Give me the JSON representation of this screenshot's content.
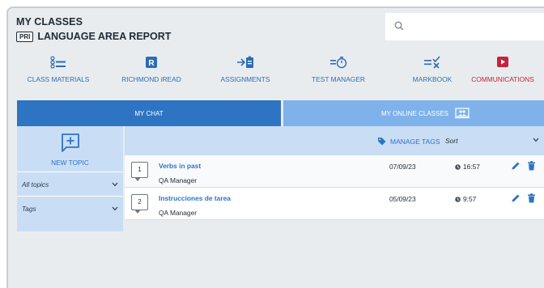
{
  "header": {
    "title": "MY CLASSES",
    "badge": "PRI",
    "subtitle": "LANGUAGE AREA REPORT"
  },
  "search": {
    "placeholder": ""
  },
  "nav": [
    {
      "label": "CLASS MATERIALS",
      "icon": "list-icon"
    },
    {
      "label": "RICHMOND iREAD",
      "icon": "richmond-r-icon"
    },
    {
      "label": "ASSIGNMENTS",
      "icon": "assignment-icon"
    },
    {
      "label": "TEST MANAGER",
      "icon": "timer-icon"
    },
    {
      "label": "MARKBOOK",
      "icon": "markbook-icon"
    },
    {
      "label": "COMMUNICATIONS",
      "icon": "play-icon"
    }
  ],
  "tabs": {
    "chat": "MY CHAT",
    "online": "MY ONLINE CLASSES"
  },
  "sidebar": {
    "new_topic": "NEW TOPIC",
    "filters": [
      {
        "label": "All topics"
      },
      {
        "label": "Tags"
      }
    ]
  },
  "toolbar": {
    "manage_tags": "MANAGE TAGS",
    "sort": "Sort"
  },
  "topics": [
    {
      "num": "1",
      "title": "Verbs in past",
      "author": "QA Manager",
      "date": "07/09/23",
      "time": "16:57"
    },
    {
      "num": "2",
      "title": "Instrucciones de tarea",
      "author": "QA Manager",
      "date": "05/09/23",
      "time": "9:57"
    }
  ],
  "colors": {
    "primary": "#2e74c2",
    "light_tab": "#7fb2ea",
    "panel": "#c9def5",
    "accent_red": "#c4233e",
    "background": "#e9ecee"
  }
}
